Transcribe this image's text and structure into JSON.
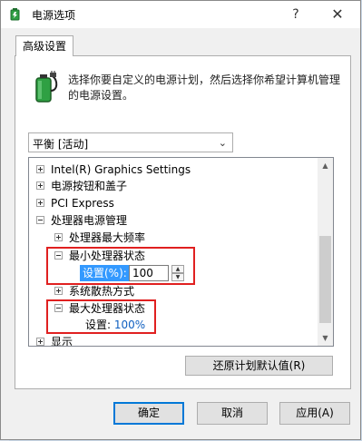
{
  "background": {
    "glyphs": [
      "X",
      "↓"
    ]
  },
  "window": {
    "title": "电源选项",
    "help_label": "?",
    "close_label": "✕"
  },
  "tab": {
    "label": "高级设置"
  },
  "description": "选择你要自定义的电源计划，然后选择你希望计算机管理的电源设置。",
  "plan_select": {
    "value": "平衡 [活动]"
  },
  "tree": {
    "items": [
      {
        "label": "Intel(R) Graphics Settings",
        "expander": "plus"
      },
      {
        "label": "电源按钮和盖子",
        "expander": "plus"
      },
      {
        "label": "PCI Express",
        "expander": "plus"
      },
      {
        "label": "处理器电源管理",
        "expander": "minus"
      },
      {
        "label": "处理器最大频率",
        "expander": "plus"
      },
      {
        "label": "最小处理器状态",
        "expander": "minus"
      },
      {
        "label": "系统散热方式",
        "expander": "plus"
      },
      {
        "label": "最大处理器状态",
        "expander": "minus"
      },
      {
        "label": "显示",
        "expander": "plus"
      }
    ],
    "min_state_setting": {
      "label": "设置(%):",
      "value": "100"
    },
    "max_state_setting": {
      "label": "设置:",
      "value": "100%"
    },
    "spin_up": "▲",
    "spin_down": "▼",
    "scroll_up": "▲",
    "scroll_down": "▼"
  },
  "restore_button": "还原计划默认值(R)",
  "buttons": {
    "ok": "确定",
    "cancel": "取消",
    "apply": "应用(A)"
  },
  "colors": {
    "highlight": "#e02020",
    "accent": "#0078d7",
    "selection": "#3399ff",
    "value_blue": "#1060c0"
  }
}
